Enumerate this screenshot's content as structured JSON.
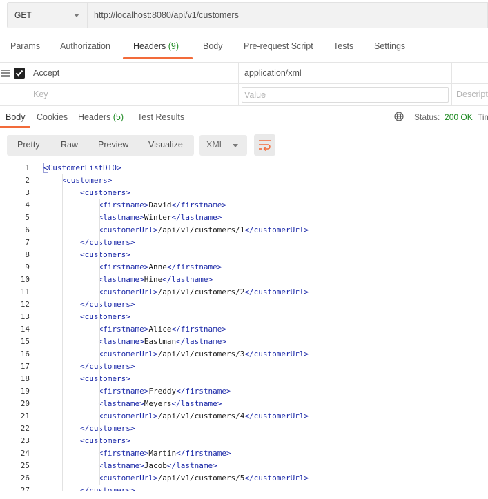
{
  "request": {
    "method": "GET",
    "url": "http://localhost:8080/api/v1/customers"
  },
  "request_tabs": [
    {
      "label": "Params",
      "count": ""
    },
    {
      "label": "Authorization",
      "count": ""
    },
    {
      "label": "Headers",
      "count": "(9)"
    },
    {
      "label": "Body",
      "count": ""
    },
    {
      "label": "Pre-request Script",
      "count": ""
    },
    {
      "label": "Tests",
      "count": ""
    },
    {
      "label": "Settings",
      "count": ""
    }
  ],
  "headers_table": {
    "row": {
      "key": "Accept",
      "value": "application/xml",
      "checked": true
    },
    "new_row": {
      "key_placeholder": "Key",
      "value_placeholder": "Value",
      "description_placeholder": "Description"
    }
  },
  "response_tabs": [
    {
      "label": "Body",
      "count": ""
    },
    {
      "label": "Cookies",
      "count": ""
    },
    {
      "label": "Headers",
      "count": "(5)"
    },
    {
      "label": "Test Results",
      "count": ""
    }
  ],
  "status": {
    "label": "Status:",
    "value": "200 OK",
    "time_label": "Time"
  },
  "view_modes": [
    "Pretty",
    "Raw",
    "Preview",
    "Visualize"
  ],
  "format": "XML",
  "colors": {
    "accent": "#f26b3a",
    "status_ok": "#1f8b24",
    "xml_tag": "#1c2aa8"
  },
  "icons": {
    "menu": "drag-handle-icon",
    "globe": "globe-icon",
    "wrap": "word-wrap-icon",
    "caret": "chevron-down-icon"
  },
  "code_lines": [
    {
      "n": "1",
      "indent": 0,
      "open": "<CustomerListDTO>",
      "text": "",
      "close": ""
    },
    {
      "n": "2",
      "indent": 1,
      "open": "<customers>",
      "text": "",
      "close": ""
    },
    {
      "n": "3",
      "indent": 2,
      "open": "<customers>",
      "text": "",
      "close": ""
    },
    {
      "n": "4",
      "indent": 3,
      "open": "<firstname>",
      "text": "David",
      "close": "</firstname>"
    },
    {
      "n": "5",
      "indent": 3,
      "open": "<lastname>",
      "text": "Winter",
      "close": "</lastname>"
    },
    {
      "n": "6",
      "indent": 3,
      "open": "<customerUrl>",
      "text": "/api/v1/customers/1",
      "close": "</customerUrl>"
    },
    {
      "n": "7",
      "indent": 2,
      "open": "</customers>",
      "text": "",
      "close": ""
    },
    {
      "n": "8",
      "indent": 2,
      "open": "<customers>",
      "text": "",
      "close": ""
    },
    {
      "n": "9",
      "indent": 3,
      "open": "<firstname>",
      "text": "Anne",
      "close": "</firstname>"
    },
    {
      "n": "10",
      "indent": 3,
      "open": "<lastname>",
      "text": "Hine",
      "close": "</lastname>"
    },
    {
      "n": "11",
      "indent": 3,
      "open": "<customerUrl>",
      "text": "/api/v1/customers/2",
      "close": "</customerUrl>"
    },
    {
      "n": "12",
      "indent": 2,
      "open": "</customers>",
      "text": "",
      "close": ""
    },
    {
      "n": "13",
      "indent": 2,
      "open": "<customers>",
      "text": "",
      "close": ""
    },
    {
      "n": "14",
      "indent": 3,
      "open": "<firstname>",
      "text": "Alice",
      "close": "</firstname>"
    },
    {
      "n": "15",
      "indent": 3,
      "open": "<lastname>",
      "text": "Eastman",
      "close": "</lastname>"
    },
    {
      "n": "16",
      "indent": 3,
      "open": "<customerUrl>",
      "text": "/api/v1/customers/3",
      "close": "</customerUrl>"
    },
    {
      "n": "17",
      "indent": 2,
      "open": "</customers>",
      "text": "",
      "close": ""
    },
    {
      "n": "18",
      "indent": 2,
      "open": "<customers>",
      "text": "",
      "close": ""
    },
    {
      "n": "19",
      "indent": 3,
      "open": "<firstname>",
      "text": "Freddy",
      "close": "</firstname>"
    },
    {
      "n": "20",
      "indent": 3,
      "open": "<lastname>",
      "text": "Meyers",
      "close": "</lastname>"
    },
    {
      "n": "21",
      "indent": 3,
      "open": "<customerUrl>",
      "text": "/api/v1/customers/4",
      "close": "</customerUrl>"
    },
    {
      "n": "22",
      "indent": 2,
      "open": "</customers>",
      "text": "",
      "close": ""
    },
    {
      "n": "23",
      "indent": 2,
      "open": "<customers>",
      "text": "",
      "close": ""
    },
    {
      "n": "24",
      "indent": 3,
      "open": "<firstname>",
      "text": "Martin",
      "close": "</firstname>"
    },
    {
      "n": "25",
      "indent": 3,
      "open": "<lastname>",
      "text": "Jacob",
      "close": "</lastname>"
    },
    {
      "n": "26",
      "indent": 3,
      "open": "<customerUrl>",
      "text": "/api/v1/customers/5",
      "close": "</customerUrl>"
    },
    {
      "n": "27",
      "indent": 2,
      "open": "</customers>",
      "text": "",
      "close": ""
    }
  ]
}
